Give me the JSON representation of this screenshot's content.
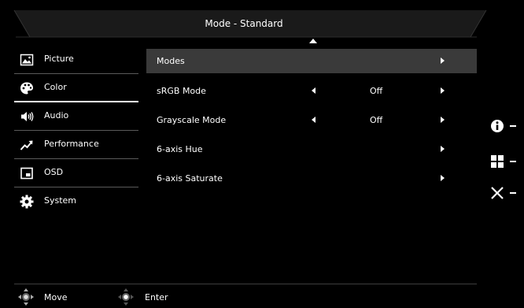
{
  "header": {
    "title": "Mode - Standard"
  },
  "sidebar": {
    "items": [
      {
        "label": "Picture",
        "icon": "picture-icon"
      },
      {
        "label": "Color",
        "icon": "palette-icon",
        "active": true
      },
      {
        "label": "Audio",
        "icon": "speaker-icon"
      },
      {
        "label": "Performance",
        "icon": "performance-icon"
      },
      {
        "label": "OSD",
        "icon": "osd-icon"
      },
      {
        "label": "System",
        "icon": "gear-icon"
      }
    ]
  },
  "menu": {
    "items": [
      {
        "label": "Modes",
        "selected": true
      },
      {
        "label": "sRGB Mode",
        "value": "Off"
      },
      {
        "label": "Grayscale Mode",
        "value": "Off"
      },
      {
        "label": "6-axis Hue"
      },
      {
        "label": "6-axis Saturate"
      }
    ]
  },
  "footer": {
    "move_label": "Move",
    "enter_label": "Enter"
  },
  "right_keys": [
    "info-icon",
    "menu-grid-icon",
    "close-icon"
  ],
  "colors": {
    "background": "#000000",
    "selected_row": "#3a3a3a",
    "text": "#ffffff",
    "divider": "#5a5a5a"
  }
}
